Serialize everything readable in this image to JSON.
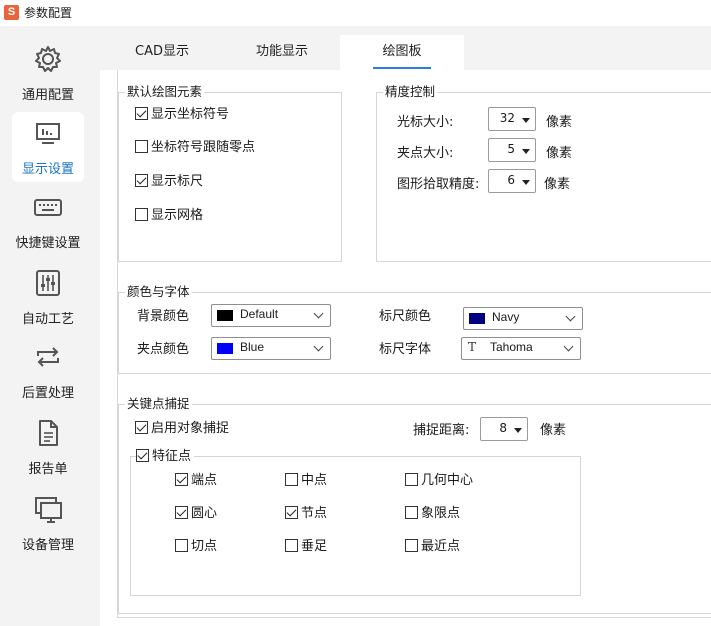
{
  "window": {
    "title": "参数配置",
    "app_icon_letter": "S"
  },
  "sidebar": {
    "items": [
      {
        "label": "通用配置",
        "icon": "gear-icon"
      },
      {
        "label": "显示设置",
        "icon": "display-chart-icon",
        "active": true
      },
      {
        "label": "快捷键设置",
        "icon": "keyboard-icon"
      },
      {
        "label": "自动工艺",
        "icon": "sliders-icon"
      },
      {
        "label": "后置处理",
        "icon": "loop-arrows-icon"
      },
      {
        "label": "报告单",
        "icon": "document-icon"
      },
      {
        "label": "设备管理",
        "icon": "monitor-icon"
      }
    ]
  },
  "tabs": [
    {
      "label": "CAD显示"
    },
    {
      "label": "功能显示"
    },
    {
      "label": "绘图板",
      "active": true
    }
  ],
  "default_elements": {
    "title": "默认绘图元素",
    "items": [
      {
        "label": "显示坐标符号",
        "checked": true
      },
      {
        "label": "坐标符号跟随零点",
        "checked": false
      },
      {
        "label": "显示标尺",
        "checked": true
      },
      {
        "label": "显示网格",
        "checked": false
      }
    ]
  },
  "precision": {
    "title": "精度控制",
    "rows": [
      {
        "label": "光标大小:",
        "value": "32",
        "unit": "像素"
      },
      {
        "label": "夹点大小:",
        "value": "5",
        "unit": "像素"
      },
      {
        "label": "图形拾取精度:",
        "value": "6",
        "unit": "像素"
      }
    ]
  },
  "colors_fonts": {
    "title": "颜色与字体",
    "bg_color": {
      "label": "背景颜色",
      "value": "Default",
      "swatch": "#000000"
    },
    "grip_color": {
      "label": "夹点颜色",
      "value": "Blue",
      "swatch": "#0000ff"
    },
    "ruler_color": {
      "label": "标尺颜色",
      "value": "Navy",
      "swatch": "#000080"
    },
    "ruler_font": {
      "label": "标尺字体",
      "value": "Tahoma",
      "glyph": "T"
    }
  },
  "snap": {
    "title": "关键点捕捉",
    "enable": {
      "label": "启用对象捕捉",
      "checked": true
    },
    "distance": {
      "label": "捕捉距离:",
      "value": "8",
      "unit": "像素"
    },
    "features": {
      "label": "特征点",
      "checked": true,
      "items": [
        {
          "label": "端点",
          "checked": true
        },
        {
          "label": "中点",
          "checked": false
        },
        {
          "label": "几何中心",
          "checked": false
        },
        {
          "label": "圆心",
          "checked": true
        },
        {
          "label": "节点",
          "checked": true
        },
        {
          "label": "象限点",
          "checked": false
        },
        {
          "label": "切点",
          "checked": false
        },
        {
          "label": "垂足",
          "checked": false
        },
        {
          "label": "最近点",
          "checked": false
        }
      ]
    }
  },
  "colors": {
    "accent": "#2a7de1",
    "sidebar_bg": "#f3f3f3"
  }
}
